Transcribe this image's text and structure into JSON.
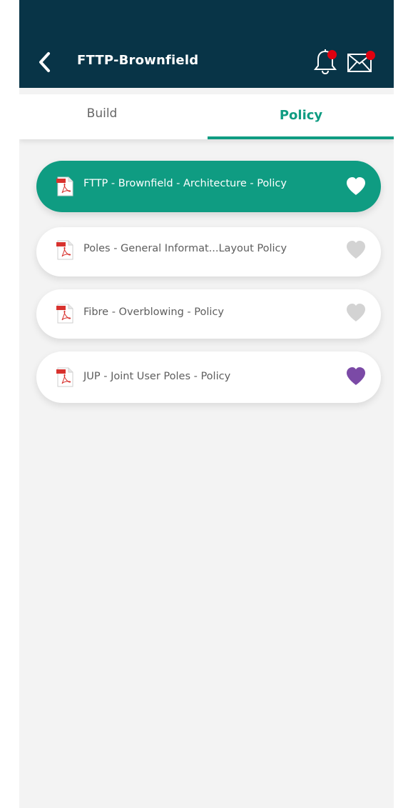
{
  "header": {
    "title": "FTTP-Brownfield",
    "back_icon": "chevron-left-icon",
    "notifications_icon": "bell-icon",
    "messages_icon": "mail-icon"
  },
  "tabs": [
    {
      "label": "Build",
      "active": false
    },
    {
      "label": "Policy",
      "active": true
    }
  ],
  "documents": [
    {
      "label": "FTTP - Brownfield - Architecture - Policy",
      "icon": "pdf-file-icon",
      "selected": true,
      "favorite_state": "white"
    },
    {
      "label": "Poles - General Informat...Layout Policy",
      "icon": "pdf-file-icon",
      "selected": false,
      "favorite_state": "off"
    },
    {
      "label": "Fibre - Overblowing - Policy",
      "icon": "pdf-file-icon",
      "selected": false,
      "favorite_state": "off"
    },
    {
      "label": "JUP - Joint User Poles - Policy",
      "icon": "pdf-file-icon",
      "selected": false,
      "favorite_state": "on"
    }
  ],
  "colors": {
    "header_bg": "#083447",
    "accent": "#0f9c82",
    "badge": "#e0000f",
    "favorite_on": "#7b4aa6",
    "favorite_off": "#d3d3d3",
    "page_bg": "#f3f3f3"
  }
}
